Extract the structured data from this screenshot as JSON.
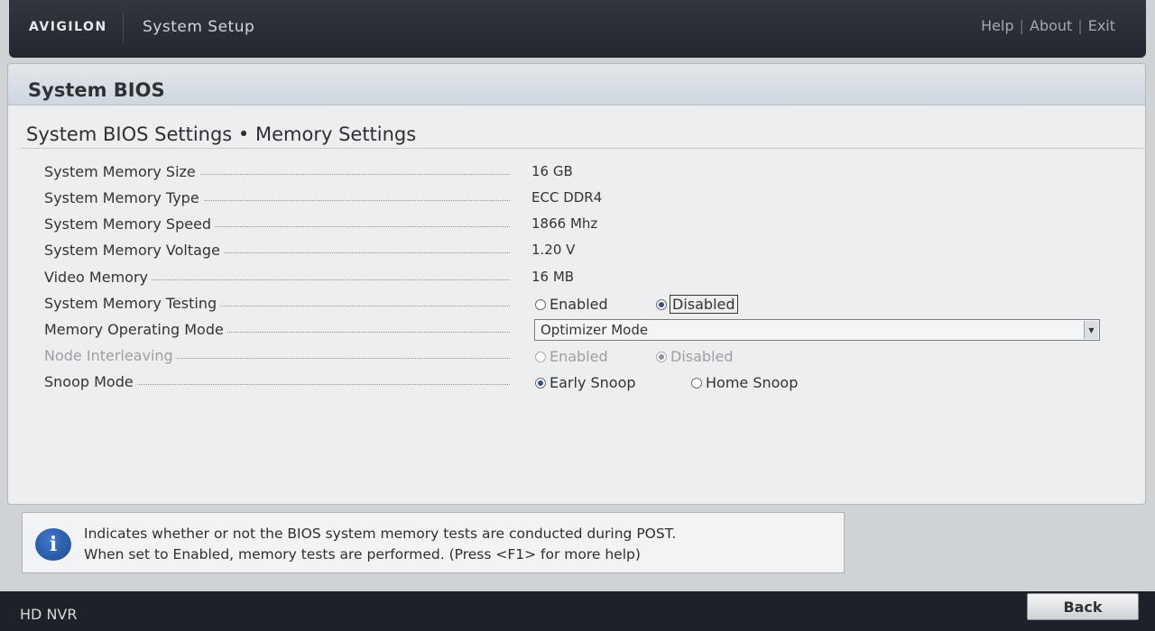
{
  "header": {
    "logo": "AVIGILON",
    "title": "System Setup",
    "links": [
      "Help",
      "About",
      "Exit"
    ]
  },
  "panel": {
    "title": "System BIOS",
    "section": "System BIOS Settings • Memory Settings"
  },
  "settings": {
    "memory_size": {
      "label": "System Memory Size",
      "value": "16 GB"
    },
    "memory_type": {
      "label": "System Memory Type",
      "value": "ECC DDR4"
    },
    "memory_speed": {
      "label": "System Memory Speed",
      "value": "1866 Mhz"
    },
    "memory_voltage": {
      "label": "System Memory Voltage",
      "value": "1.20 V"
    },
    "video_memory": {
      "label": "Video Memory",
      "value": "16 MB"
    },
    "memory_testing": {
      "label": "System Memory Testing",
      "options": [
        "Enabled",
        "Disabled"
      ],
      "selected": "Disabled"
    },
    "operating_mode": {
      "label": "Memory Operating Mode",
      "value": "Optimizer Mode"
    },
    "node_interleaving": {
      "label": "Node Interleaving",
      "options": [
        "Enabled",
        "Disabled"
      ],
      "selected": "Disabled",
      "disabled": true
    },
    "snoop_mode": {
      "label": "Snoop Mode",
      "options": [
        "Early Snoop",
        "Home Snoop"
      ],
      "selected": "Early Snoop"
    }
  },
  "help": {
    "line1": "Indicates whether or not the BIOS system memory tests are conducted during POST.",
    "line2": "When set to Enabled, memory tests are performed. (Press <F1> for more help)"
  },
  "footer": {
    "model": "HD NVR",
    "back_label": "Back"
  },
  "colors": {
    "topbar": "#2b2d35",
    "panel_bg": "#eceeef",
    "radio_selected": "#3a4f8a",
    "info_icon": "#2a5ca8"
  }
}
